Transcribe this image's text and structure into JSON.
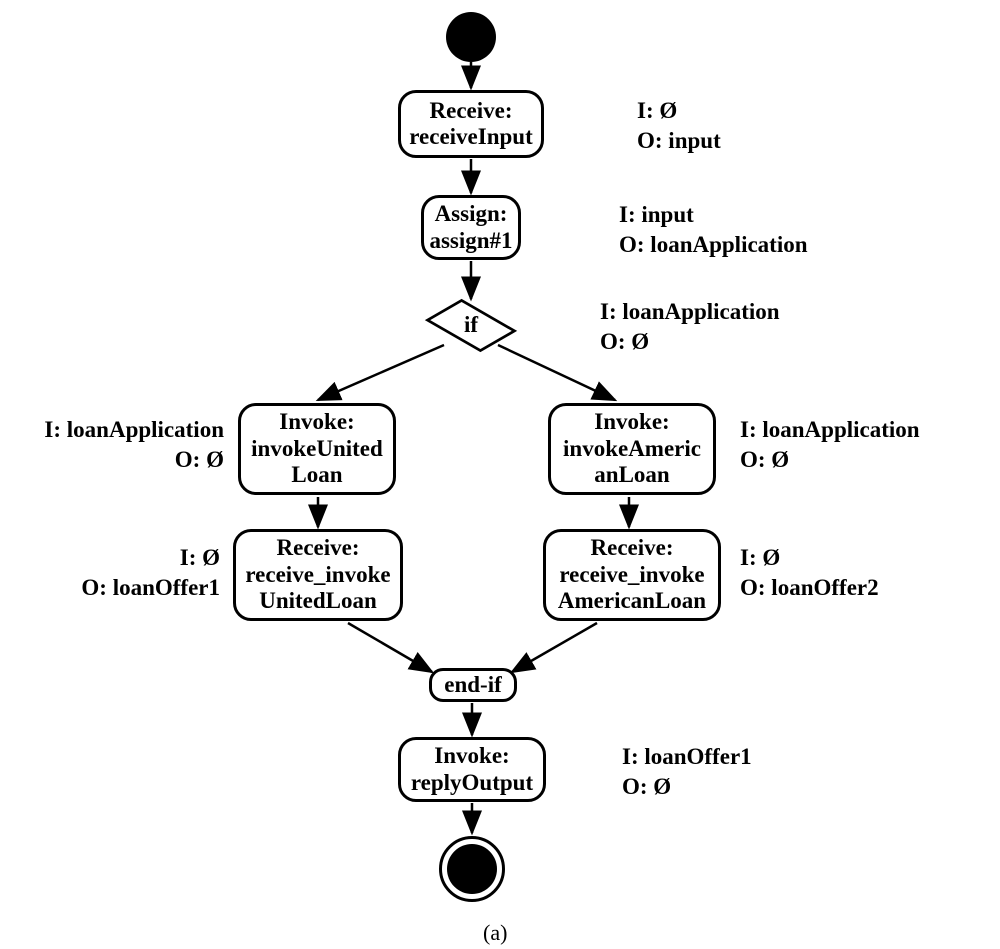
{
  "nodes": {
    "receive_input": {
      "line1": "Receive:",
      "line2": "receiveInput"
    },
    "assign": {
      "line1": "Assign:",
      "line2": "assign#1"
    },
    "if": "if",
    "invoke_united": {
      "line1": "Invoke:",
      "line2": "invokeUnited",
      "line3": "Loan"
    },
    "invoke_american": {
      "line1": "Invoke:",
      "line2": "invokeAmeric",
      "line3": "anLoan"
    },
    "receive_united": {
      "line1": "Receive:",
      "line2": "receive_invoke",
      "line3": "UnitedLoan"
    },
    "receive_american": {
      "line1": "Receive:",
      "line2": "receive_invoke",
      "line3": "AmericanLoan"
    },
    "end_if": "end-if",
    "reply_output": {
      "line1": "Invoke:",
      "line2": "replyOutput"
    }
  },
  "io": {
    "receive_input": {
      "i": "I: Ø",
      "o": "O: input"
    },
    "assign": {
      "i": "I: input",
      "o": "O: loanApplication"
    },
    "if": {
      "i": "I: loanApplication",
      "o": "O: Ø"
    },
    "invoke_united": {
      "i": "I: loanApplication",
      "o": "O: Ø"
    },
    "invoke_american": {
      "i": "I: loanApplication",
      "o": "O: Ø"
    },
    "receive_united": {
      "i": "I: Ø",
      "o": "O: loanOffer1"
    },
    "receive_american": {
      "i": "I: Ø",
      "o": "O: loanOffer2"
    },
    "reply_output": {
      "i": "I: loanOffer1",
      "o": "O: Ø"
    }
  },
  "caption": "(a)"
}
